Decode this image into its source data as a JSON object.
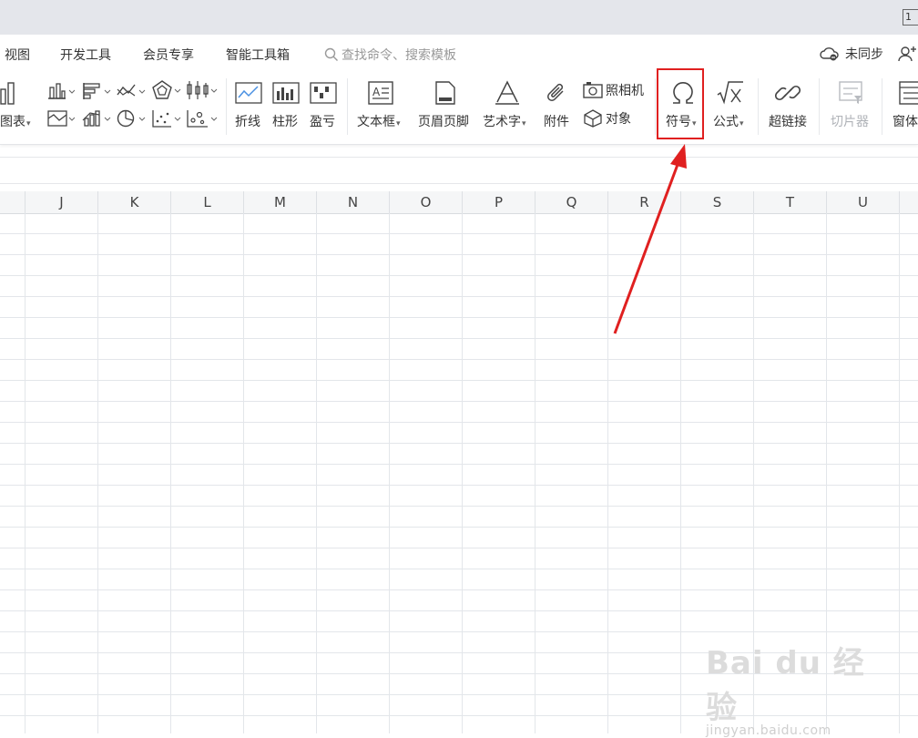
{
  "titlebar": {
    "badge": "1"
  },
  "menu": {
    "items": [
      "视图",
      "开发工具",
      "会员专享",
      "智能工具箱"
    ],
    "search_placeholder": "查找命令、搜索模板",
    "sync_label": "未同步"
  },
  "ribbon": {
    "chart_label": "图表",
    "line_label": "折线",
    "column_label": "柱形",
    "winloss_label": "盈亏",
    "textbox_label": "文本框",
    "header_footer_label": "页眉页脚",
    "wordart_label": "艺术字",
    "attachment_label": "附件",
    "camera_label": "照相机",
    "object_label": "对象",
    "symbol_label": "符号",
    "formula_label": "公式",
    "hyperlink_label": "超链接",
    "slicer_label": "切片器",
    "window_label": "窗体"
  },
  "columns": [
    "J",
    "K",
    "L",
    "M",
    "N",
    "O",
    "P",
    "Q",
    "R",
    "S",
    "T",
    "U"
  ],
  "annotation": {
    "highlight_color": "#e02020",
    "target": "symbol-button"
  },
  "watermark": {
    "logo": "Bai du 经验",
    "url": "jingyan.baidu.com"
  }
}
